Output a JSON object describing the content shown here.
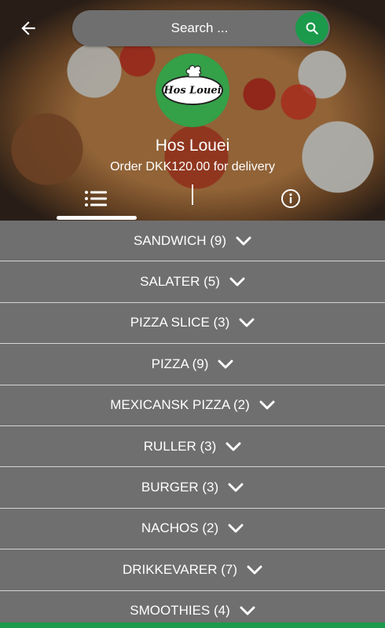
{
  "header": {
    "search_placeholder": "Search ...",
    "restaurant_name": "Hos Louei",
    "delivery_note": "Order DKK120.00 for delivery",
    "logo_text": "Hos Louei"
  },
  "tabs": [
    {
      "icon": "list-icon",
      "active": true
    },
    {
      "icon": "info-icon",
      "active": false
    }
  ],
  "categories": [
    {
      "label": "SANDWICH (9)"
    },
    {
      "label": "SALATER (5)"
    },
    {
      "label": "PIZZA SLICE (3)"
    },
    {
      "label": "PIZZA (9)"
    },
    {
      "label": "MEXICANSK PIZZA (2)"
    },
    {
      "label": "RULLER (3)"
    },
    {
      "label": "BURGER (3)"
    },
    {
      "label": "NACHOS (2)"
    },
    {
      "label": "DRIKKEVARER (7)"
    },
    {
      "label": "SMOOTHIES (4)"
    }
  ],
  "colors": {
    "accent": "#1a9a4a",
    "row_background": "#6f6f6f",
    "logo_background": "#34a048"
  }
}
